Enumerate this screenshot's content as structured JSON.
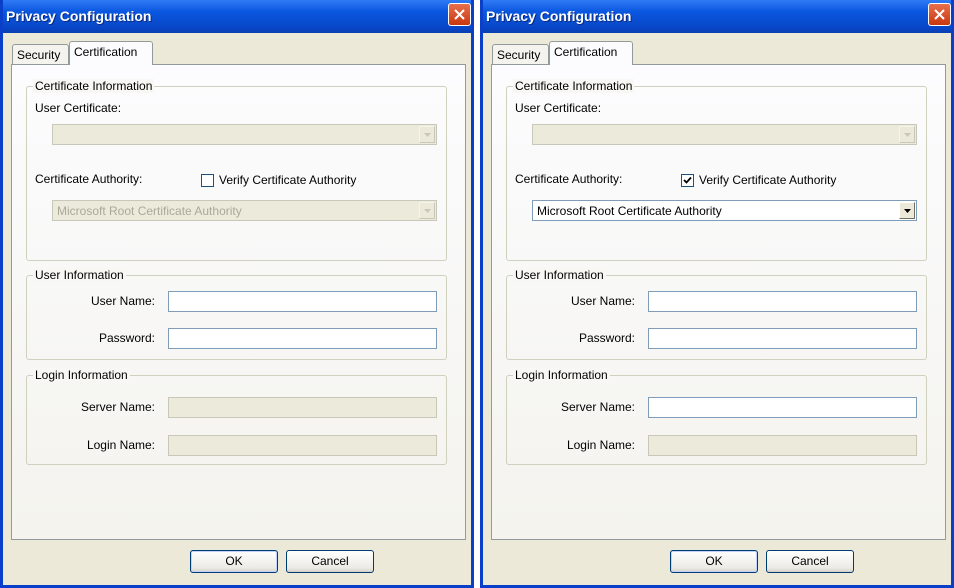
{
  "dialogs": [
    {
      "title": "Privacy Configuration",
      "tabs": [
        "Security",
        "Certification"
      ],
      "certificate_group": "Certificate Information",
      "user_certificate_label": "User Certificate:",
      "user_certificate_value": "",
      "certificate_authority_label": "Certificate Authority:",
      "verify_label": "Verify Certificate Authority",
      "verify_checked": false,
      "authority_value": "Microsoft Root Certificate Authority",
      "user_group": "User Information",
      "user_name_label": "User Name:",
      "password_label": "Password:",
      "login_group": "Login Information",
      "server_name_label": "Server Name:",
      "login_name_label": "Login Name:",
      "ok_label": "OK",
      "cancel_label": "Cancel"
    },
    {
      "title": "Privacy Configuration",
      "tabs": [
        "Security",
        "Certification"
      ],
      "certificate_group": "Certificate Information",
      "user_certificate_label": "User Certificate:",
      "user_certificate_value": "",
      "certificate_authority_label": "Certificate Authority:",
      "verify_label": "Verify Certificate Authority",
      "verify_checked": true,
      "authority_value": "Microsoft Root Certificate Authority",
      "user_group": "User Information",
      "user_name_label": "User Name:",
      "password_label": "Password:",
      "login_group": "Login Information",
      "server_name_label": "Server Name:",
      "login_name_label": "Login Name:",
      "ok_label": "OK",
      "cancel_label": "Cancel"
    }
  ]
}
